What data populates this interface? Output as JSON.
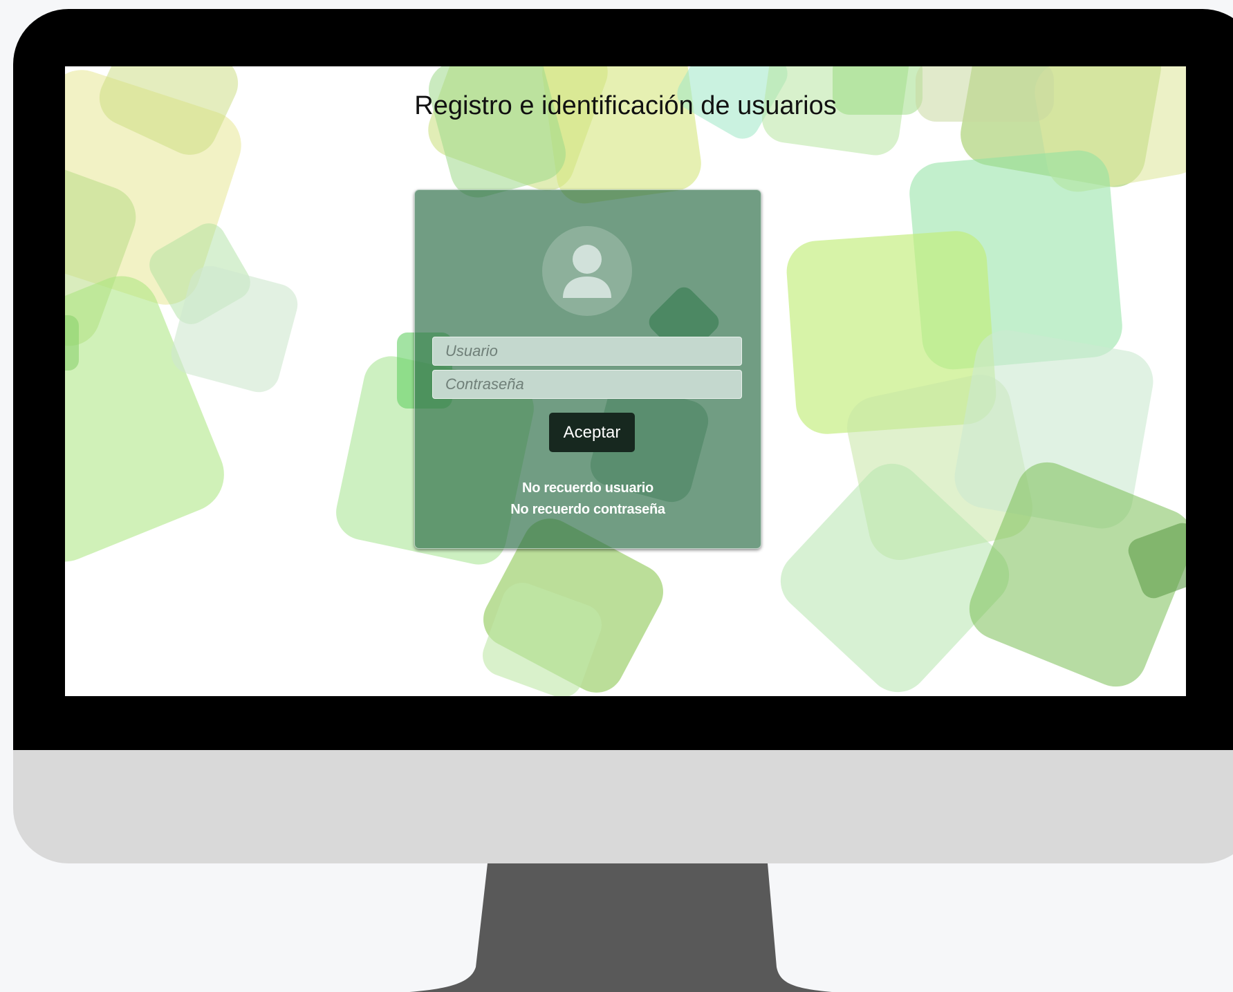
{
  "page": {
    "title": "Registro e identificación de usuarios"
  },
  "login_form": {
    "username_placeholder": "Usuario",
    "password_placeholder": "Contraseña",
    "submit_label": "Aceptar",
    "forgot_user_link": "No recuerdo usuario",
    "forgot_password_link": "No recuerdo contraseña",
    "avatar_icon": "user-icon"
  },
  "colors": {
    "card_background": "#2d6e48",
    "submit_button": "#17281f",
    "input_background": "#c4d8ce",
    "monitor_bezel": "#000000",
    "monitor_chin": "#d9d9d9",
    "monitor_stand": "#595959"
  }
}
